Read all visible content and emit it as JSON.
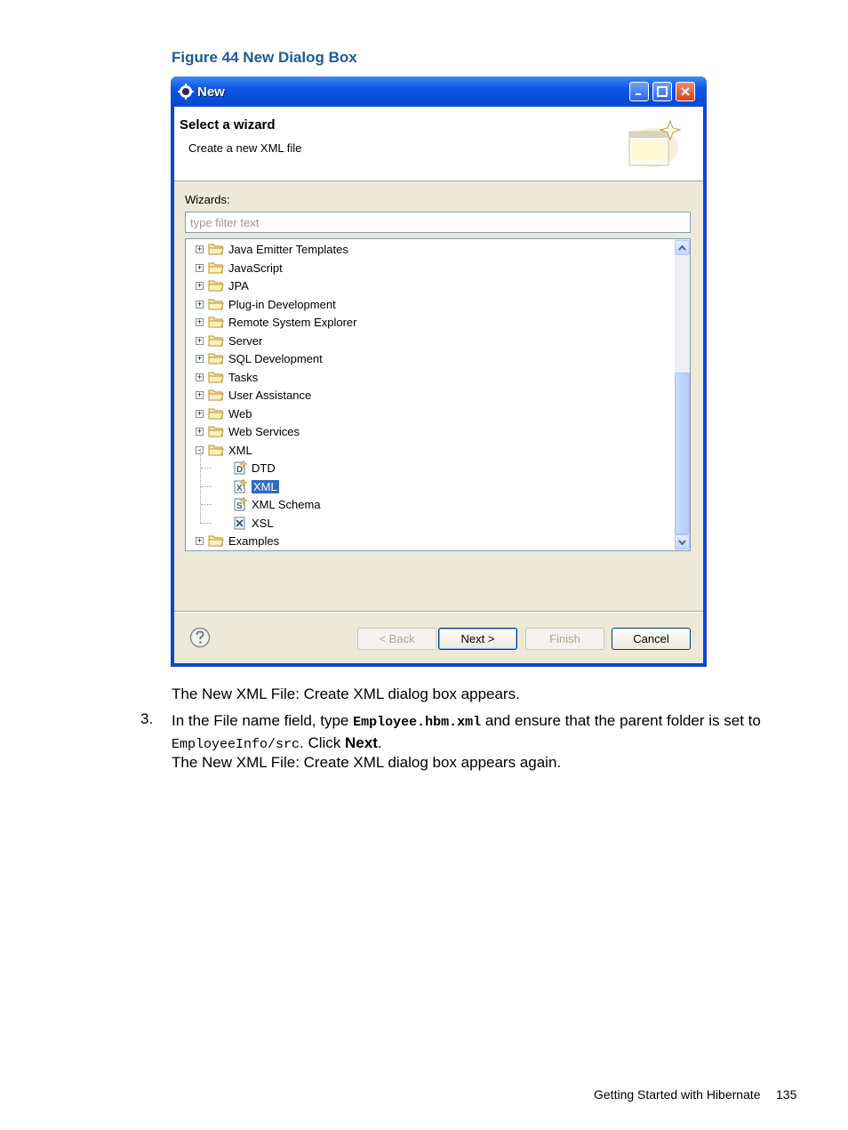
{
  "caption": "Figure 44 New Dialog Box",
  "dialog": {
    "title": "New",
    "heading": "Select a wizard",
    "subheading": "Create a new XML file",
    "wizards_label": "Wizards:",
    "filter_placeholder": "type filter text",
    "tree": [
      {
        "label": "Java Emitter Templates",
        "icon": "folder-icon",
        "expander": "+"
      },
      {
        "label": "JavaScript",
        "icon": "folder-icon",
        "expander": "+"
      },
      {
        "label": "JPA",
        "icon": "folder-icon",
        "expander": "+"
      },
      {
        "label": "Plug-in Development",
        "icon": "folder-icon",
        "expander": "+"
      },
      {
        "label": "Remote System Explorer",
        "icon": "folder-icon",
        "expander": "+"
      },
      {
        "label": "Server",
        "icon": "folder-icon",
        "expander": "+"
      },
      {
        "label": "SQL Development",
        "icon": "folder-icon",
        "expander": "+"
      },
      {
        "label": "Tasks",
        "icon": "folder-icon",
        "expander": "+"
      },
      {
        "label": "User Assistance",
        "icon": "folder-icon",
        "expander": "+"
      },
      {
        "label": "Web",
        "icon": "folder-icon",
        "expander": "+"
      },
      {
        "label": "Web Services",
        "icon": "folder-icon",
        "expander": "+"
      },
      {
        "label": "XML",
        "icon": "folder-icon",
        "expander": "-"
      },
      {
        "label": "DTD",
        "icon": "dtd-file-icon",
        "child": true
      },
      {
        "label": "XML",
        "icon": "xml-file-icon",
        "child": true,
        "selected": true
      },
      {
        "label": "XML Schema",
        "icon": "schema-file-icon",
        "child": true
      },
      {
        "label": "XSL",
        "icon": "xsl-file-icon",
        "child": true
      },
      {
        "label": "Examples",
        "icon": "folder-icon",
        "expander": "+"
      }
    ],
    "buttons": {
      "back": "< Back",
      "next": "Next >",
      "finish": "Finish",
      "cancel": "Cancel"
    }
  },
  "body": {
    "p1": "The New XML File: Create XML dialog box appears.",
    "step_number": "3.",
    "step_text_1": "In the File name field, type ",
    "step_code_1": "Employee.hbm.xml",
    "step_text_2": " and ensure that the parent folder is set to",
    "step_code_2": "EmployeeInfo/src",
    "step_text_3": ". Click ",
    "step_bold": "Next",
    "step_text_4": ".",
    "p2": "The New XML File: Create XML dialog box appears again."
  },
  "footer": {
    "section": "Getting Started with Hibernate",
    "page": "135"
  }
}
